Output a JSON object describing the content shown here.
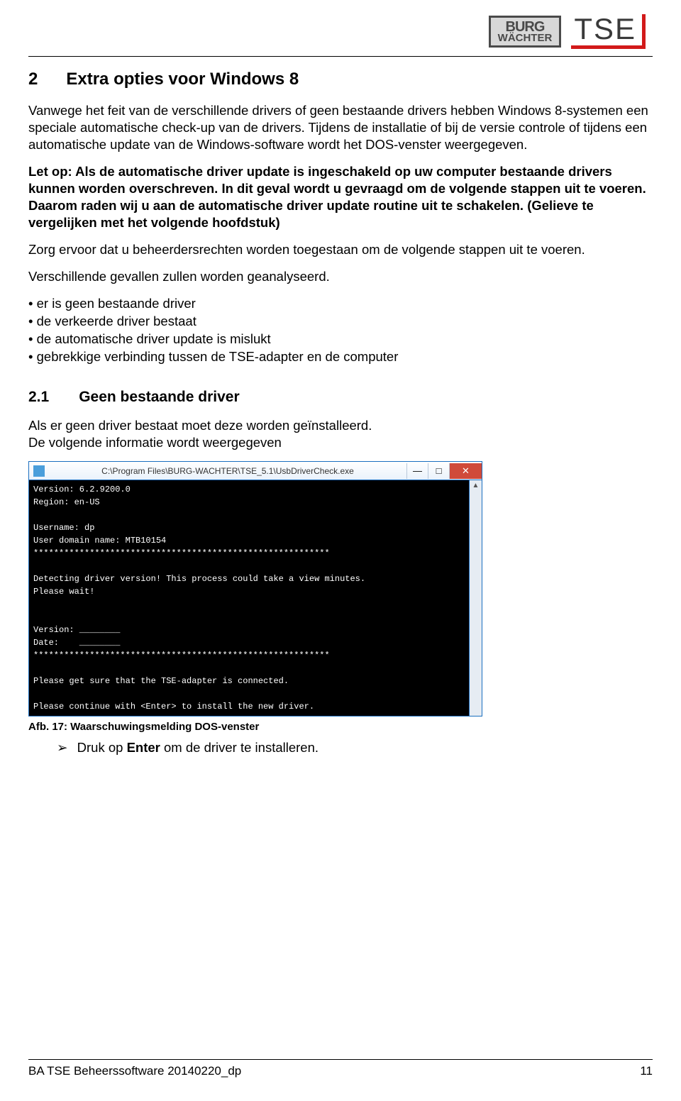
{
  "logos": {
    "bw_line1": "BURG",
    "bw_line2": "WÄCHTER",
    "tse": "TSE"
  },
  "section": {
    "num": "2",
    "title": "Extra opties voor Windows 8",
    "p1": "Vanwege het feit van de verschillende drivers of geen bestaande drivers hebben Windows 8-systemen een speciale automatische check-up van de drivers. Tijdens de installatie of bij de versie controle of tijdens een automatische update van de Windows-software wordt het DOS-venster weergegeven.",
    "p2_bold": "Let op: Als de automatische driver update is ingeschakeld op uw computer bestaande drivers kunnen worden overschreven. In dit geval wordt u gevraagd om de volgende stappen uit te voeren.\nDaarom raden wij u aan de automatische driver update routine uit te schakelen. (Gelieve te vergelijken met het volgende hoofdstuk)",
    "p3": "Zorg ervoor dat u beheerdersrechten worden toegestaan om de volgende stappen uit te voeren.",
    "p4": "Verschillende gevallen zullen worden geanalyseerd.",
    "bullets": [
      "er is geen bestaande driver",
      "de verkeerde driver bestaat",
      "de automatische driver update is mislukt",
      "gebrekkige verbinding tussen de TSE-adapter en de computer"
    ]
  },
  "subsection": {
    "num": "2.1",
    "title": "Geen bestaande driver",
    "p1": "Als er geen driver bestaat moet deze worden geïnstalleerd.\nDe volgende informatie wordt weergegeven"
  },
  "dos": {
    "path": "C:\\Program Files\\BURG-WACHTER\\TSE_5.1\\UsbDriverCheck.exe",
    "lines": "Version: 6.2.9200.0\nRegion: en-US\n\nUsername: dp\nUser domain name: MTB10154\n**********************************************************\n\nDetecting driver version! This process could take a view minutes.\nPlease wait!\n\n\nVersion: ________\nDate:    ________\n**********************************************************\n\nPlease get sure that the TSE-adapter is connected.\n\nPlease continue with <Enter> to install the new driver.",
    "min": "—",
    "max": "□",
    "close": "✕",
    "scroll_up": "▲"
  },
  "caption": "Afb. 17: Waarschuwingsmelding DOS-venster",
  "action": {
    "tri": "➢",
    "pre": "Druk op ",
    "bold": "Enter",
    "post": " om de driver te installeren."
  },
  "footer": {
    "left": "BA TSE Beheerssoftware 20140220_dp",
    "right": "11"
  }
}
